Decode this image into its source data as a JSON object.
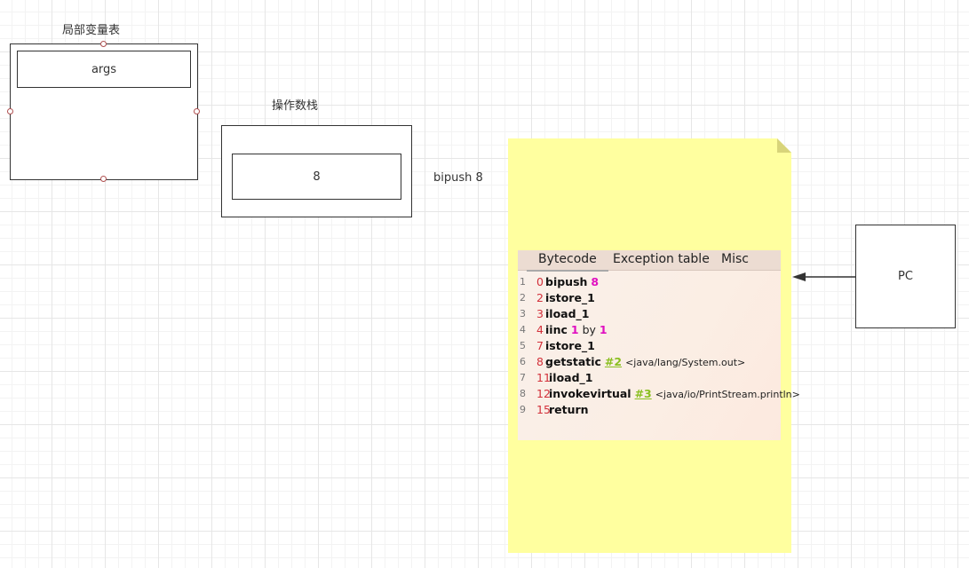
{
  "local_vars": {
    "title": "局部变量表",
    "slot": "args"
  },
  "operand_stack": {
    "title": "操作数栈",
    "value": "8"
  },
  "instruction_label": "bipush 8",
  "pc_label": "PC",
  "bytecode_panel": {
    "tabs": [
      {
        "label": "Bytecode",
        "active": true
      },
      {
        "label": "Exception table",
        "active": false
      },
      {
        "label": "Misc",
        "active": false
      }
    ],
    "lines": [
      {
        "line": "1",
        "offset": "0",
        "op": "bipush",
        "arg": "8"
      },
      {
        "line": "2",
        "offset": "2",
        "op": "istore_1"
      },
      {
        "line": "3",
        "offset": "3",
        "op": "iload_1"
      },
      {
        "line": "4",
        "offset": "4",
        "op": "iinc",
        "arg": "1",
        "by": "by",
        "arg2": "1"
      },
      {
        "line": "5",
        "offset": "7",
        "op": "istore_1"
      },
      {
        "line": "6",
        "offset": "8",
        "op": "getstatic",
        "ref": "#2",
        "comment": "<java/lang/System.out>"
      },
      {
        "line": "7",
        "offset": "11",
        "op": "iload_1"
      },
      {
        "line": "8",
        "offset": "12",
        "op": "invokevirtual",
        "ref": "#3",
        "comment": "<java/io/PrintStream.println>"
      },
      {
        "line": "9",
        "offset": "15",
        "op": "return"
      }
    ]
  },
  "colors": {
    "note": "#ffff9f",
    "offset": "#d2303a",
    "number": "#e010c0",
    "reference": "#8abf20"
  }
}
